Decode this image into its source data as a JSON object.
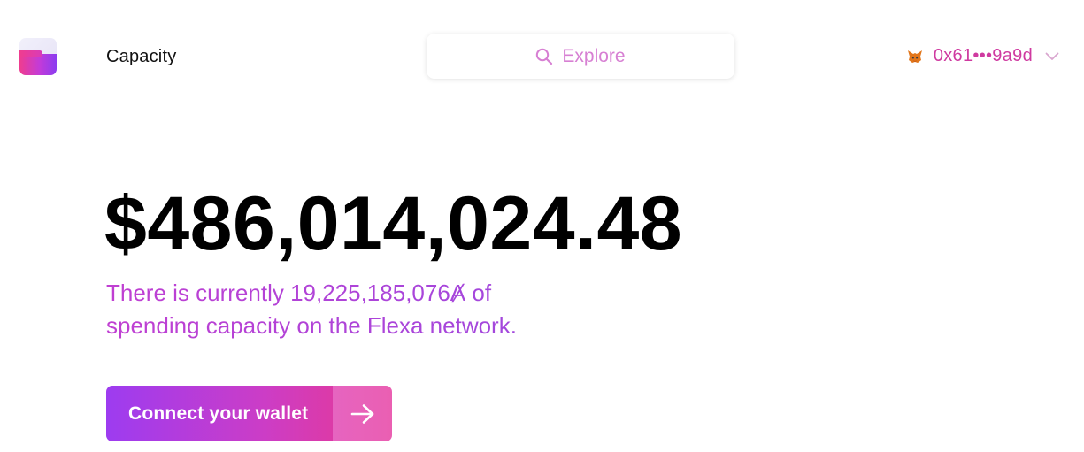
{
  "header": {
    "app_title": "Capacity",
    "logo_icon": "flexa-logo-icon",
    "explore": {
      "icon": "search-icon",
      "label": "Explore"
    },
    "wallet": {
      "icon": "metamask-fox-icon",
      "address": "0x61•••9a9d",
      "dropdown_icon": "chevron-down-icon"
    }
  },
  "main": {
    "amount": "$486,014,024.48",
    "description_line1": "There is currently 19,225,185,076Ⱥ of",
    "description_line2": "spending capacity on the Flexa network.",
    "cta": {
      "label": "Connect your wallet",
      "icon": "arrow-right-icon"
    }
  },
  "colors": {
    "accent_pink": "#cf3aa0",
    "accent_purple": "#9d3cf0",
    "explore_text": "#d780d3",
    "description_text": "#b43fd1"
  }
}
